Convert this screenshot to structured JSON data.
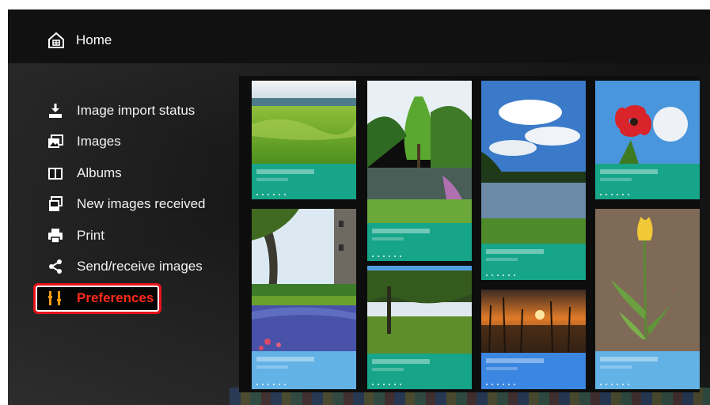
{
  "menu": {
    "home_label": "Home",
    "items": [
      {
        "label": "Image import status",
        "icon": "import-icon"
      },
      {
        "label": "Images",
        "icon": "images-icon"
      },
      {
        "label": "Albums",
        "icon": "albums-icon"
      },
      {
        "label": "New images received",
        "icon": "new-images-icon"
      },
      {
        "label": "Print",
        "icon": "printer-icon"
      },
      {
        "label": "Send/receive images",
        "icon": "share-icon"
      }
    ],
    "selected": {
      "label": "Preferences",
      "icon": "preferences-icon"
    }
  },
  "colors": {
    "highlight": "#e8121a",
    "teal_card": "#17a589",
    "blue_card": "#4d9fe0"
  }
}
